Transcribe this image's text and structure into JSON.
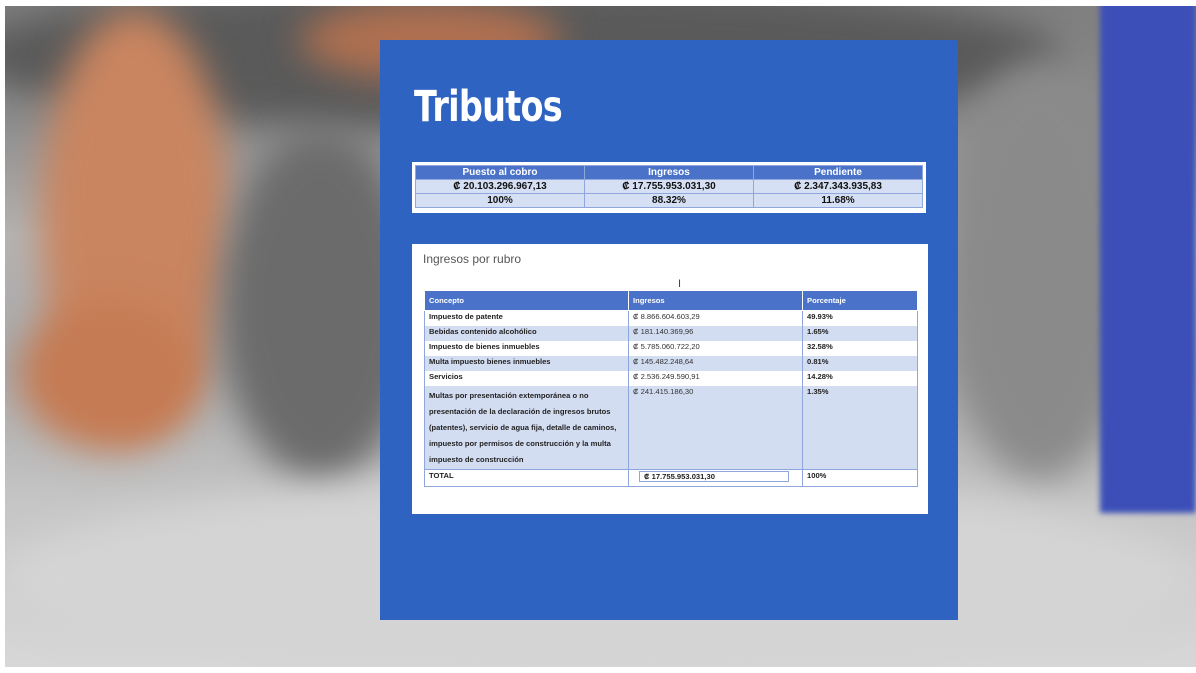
{
  "slide": {
    "title": "Tributos"
  },
  "summary": {
    "headers": [
      "Puesto al cobro",
      "Ingresos",
      "Pendiente"
    ],
    "amounts": [
      "₡ 20.103.296.967,13",
      "₡  17.755.953.031,30",
      "₡  2.347.343.935,83"
    ],
    "percents": [
      "100%",
      "88.32%",
      "11.68%"
    ]
  },
  "rubro": {
    "title": "Ingresos por rubro",
    "headers": [
      "Concepto",
      "Ingresos",
      "Porcentaje"
    ],
    "rows": [
      {
        "concept": "Impuesto de patente",
        "income": "₡ 8.866.604.603,29",
        "percent": "49.93%"
      },
      {
        "concept": "Bebidas contenido alcohólico",
        "income": "₡   181.140.369,96",
        "percent": "1.65%"
      },
      {
        "concept": "Impuesto de bienes inmuebles",
        "income": "₡ 5.785.060.722,20",
        "percent": "32.58%"
      },
      {
        "concept": "Multa impuesto bienes inmuebles",
        "income": "₡   145.482.248,64",
        "percent": "0.81%"
      },
      {
        "concept": "Servicios",
        "income": "₡ 2.536.249.590,91",
        "percent": "14.28%"
      },
      {
        "concept": "Multas por presentación extemporánea o no presentación de la declaración de ingresos brutos (patentes), servicio de agua fija, detalle de caminos, impuesto por permisos de construcción y la multa impuesto de construcción",
        "income": "₡   241.415.186,30",
        "percent": "1.35%"
      }
    ],
    "total": {
      "label": "TOTAL",
      "income": "₡    17.755.953.031,30",
      "percent": "100%"
    }
  },
  "colors": {
    "slide_bg": "#2f63c2",
    "header_bg": "#4a72c8",
    "row_alt": "#d3ddf2",
    "right_panel": "#3c4fb8"
  },
  "icons": {
    "cursor": "text-cursor-icon"
  }
}
